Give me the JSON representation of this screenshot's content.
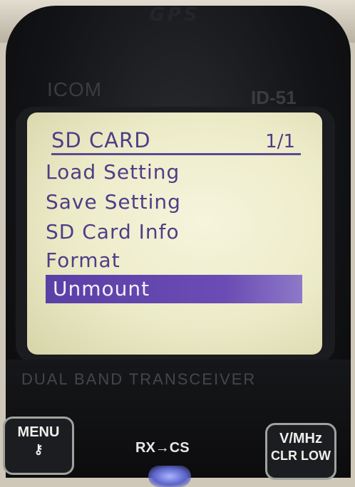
{
  "device": {
    "gps_label": "GPS",
    "brand": "ICOM",
    "model": "ID-51",
    "subtitle": "DUAL BAND TRANSCEIVER"
  },
  "lcd": {
    "title": "SD CARD",
    "page": "1/1",
    "items": [
      {
        "label": "Load Setting"
      },
      {
        "label": "Save Setting"
      },
      {
        "label": "SD Card Info"
      },
      {
        "label": "Format"
      },
      {
        "label": "Unmount",
        "selected": true
      }
    ]
  },
  "keys": {
    "menu": {
      "line1": "MENU",
      "line2": "⚷"
    },
    "rxcs": "RX→CS",
    "vmhz": {
      "line1": "V/MHz",
      "line2": "CLR LOW"
    }
  },
  "colors": {
    "lcd_background": "#ecebc8",
    "lcd_text": "#4e3e86",
    "highlight": "#5a3fa6"
  }
}
